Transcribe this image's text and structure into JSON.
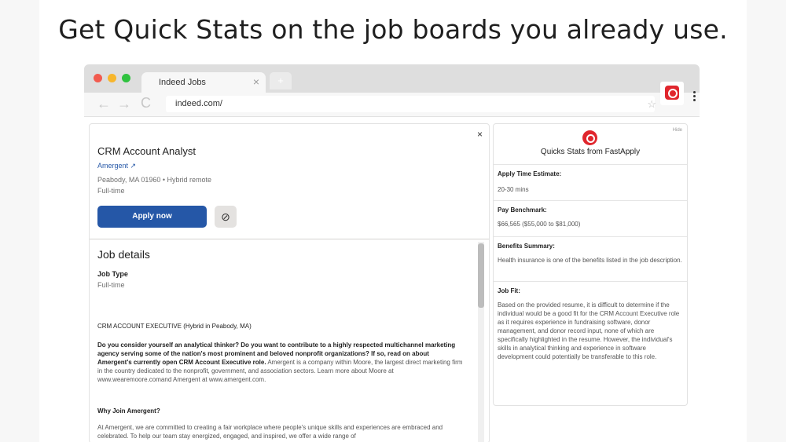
{
  "headline": "Get Quick Stats on the job boards you already use.",
  "browser": {
    "tab_title": "Indeed Jobs",
    "tab_close": "×",
    "new_tab": "+",
    "url": "indeed.com/",
    "back": "←",
    "forward": "→",
    "reload": "C",
    "star": "☆"
  },
  "job": {
    "close": "×",
    "title": "CRM Account Analyst",
    "company": "Amergent",
    "company_link_icon": "↗",
    "location": "Peabody, MA 01960  •  Hybrid remote",
    "job_time": "Full-time",
    "apply_label": "Apply now",
    "not_interested_icon": "⊘",
    "details_heading": "Job details",
    "job_type_label": "Job Type",
    "job_type_value": "Full-time",
    "desc_heading": "CRM ACCOUNT EXECUTIVE (Hybrid in Peabody, MA)",
    "desc_intro_bold": "Do you consider yourself an analytical thinker? Do you want to contribute to a highly respected multichannel marketing agency serving some of the nation's most prominent and beloved nonprofit organizations? If so, read on about Amergent's currently open CRM Account Executive role.",
    "desc_intro_rest": " Amergent is a company within Moore, the largest direct marketing firm in the country dedicated to the nonprofit, government, and association sectors. Learn more about Moore at www.wearemoore.comand Amergent at www.amergent.com.",
    "why_heading": "Why Join Amergent?",
    "why_text": "At Amergent, we are committed to creating a fair workplace where people's unique skills and experiences are embraced and celebrated. To help our team stay energized, engaged, and inspired, we offer a wide range of"
  },
  "fastapply": {
    "hide": "Hide",
    "title": "Quicks Stats from FastApply",
    "sections": [
      {
        "label": "Apply Time Estimate:",
        "value": "20-30 mins"
      },
      {
        "label": "Pay Benchmark:",
        "value": "$66,565 ($55,000 to $81,000)"
      },
      {
        "label": "Benefits Summary:",
        "value": "Health insurance is one of the benefits listed in the job description."
      },
      {
        "label": "Job Fit:",
        "value": "Based on the provided resume, it is difficult to determine if the individual would be a good fit for the CRM Account Executive role as it requires experience in fundraising software, donor management, and donor record input, none of which are specifically highlighted in the resume. However, the individual's skills in analytical thinking and experience in software development could potentially be transferable to this role."
      }
    ]
  },
  "colors": {
    "apply_blue": "#2557a7",
    "fastapply_red": "#e0262d"
  },
  "icons": {
    "extension": "fastapply-extension-icon",
    "menu": "kebab-menu-icon"
  }
}
